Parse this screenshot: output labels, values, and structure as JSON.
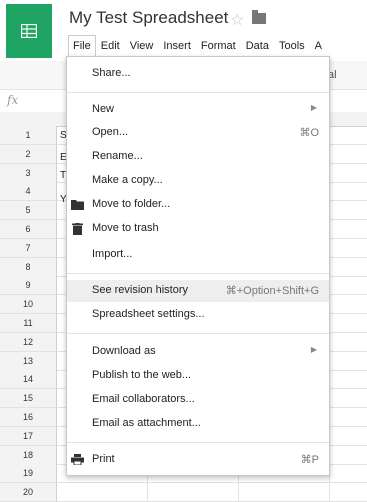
{
  "app": {
    "title": "My Test Spreadsheet",
    "brand_color": "#1fa463"
  },
  "menubar": {
    "items": [
      "File",
      "Edit",
      "View",
      "Insert",
      "Format",
      "Data",
      "Tools",
      "A"
    ]
  },
  "toolbar": {
    "label": "al"
  },
  "formula_bar": {
    "fx_label": "fx"
  },
  "grid": {
    "rows": [
      "1",
      "2",
      "3",
      "4",
      "5",
      "6",
      "7",
      "8",
      "9",
      "10",
      "11",
      "12",
      "13",
      "14",
      "15",
      "16",
      "17",
      "18",
      "19",
      "20"
    ],
    "cell_fragments": [
      "S",
      "E",
      "T",
      "Y"
    ]
  },
  "file_menu": {
    "share": "Share...",
    "new": "New",
    "open": "Open...",
    "open_shortcut": "⌘O",
    "rename": "Rename...",
    "make_copy": "Make a copy...",
    "move_folder": "Move to folder...",
    "move_trash": "Move to trash",
    "import": "Import...",
    "revision_history": "See revision history",
    "revision_shortcut": "⌘+Option+Shift+G",
    "settings": "Spreadsheet settings...",
    "download": "Download as",
    "publish": "Publish to the web...",
    "email_collab": "Email collaborators...",
    "email_attach": "Email as attachment...",
    "print": "Print",
    "print_shortcut": "⌘P"
  }
}
